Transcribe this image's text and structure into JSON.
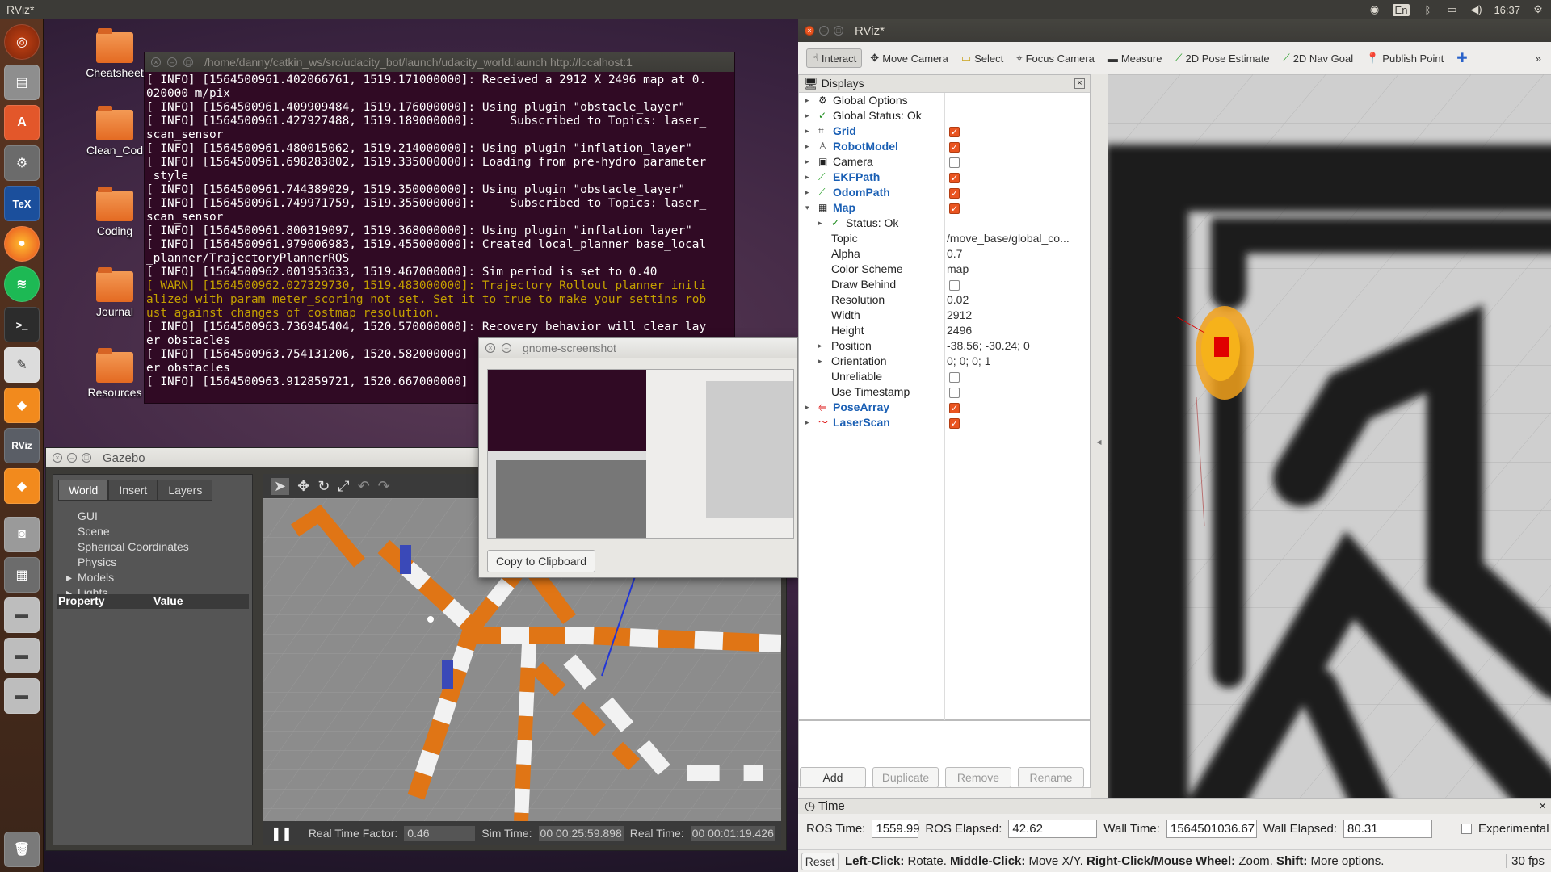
{
  "topbar": {
    "title": "RViz*",
    "time": "16:37",
    "lang": "En",
    "icons": [
      "wifi-icon",
      "keyboard-lang-icon",
      "bluetooth-icon",
      "battery-icon",
      "volume-icon",
      "settings-gear-icon"
    ]
  },
  "launcher": {
    "icons": [
      "ubuntu-dash-icon",
      "files-icon",
      "software-center-icon",
      "system-settings-icon",
      "texmaker-icon",
      "firefox-icon",
      "spotify-icon",
      "terminal-icon",
      "text-editor-icon",
      "sublime-icon",
      "rviz-icon",
      "sublime-icon",
      "screenshot-icon",
      "workspace-icon",
      "drive-icon",
      "drive-icon",
      "drive-icon",
      "trash-icon"
    ],
    "rviz_label": "RViz"
  },
  "desktop": {
    "folders": [
      "Cheatsheet",
      "Clean_Cod",
      "Coding",
      "Journal",
      "Resources"
    ]
  },
  "terminal": {
    "title": "/home/danny/catkin_ws/src/udacity_bot/launch/udacity_world.launch http://localhost:1",
    "lines": [
      "[ INFO] [1564500961.402066761, 1519.171000000]: Received a 2912 X 2496 map at 0.",
      "020000 m/pix",
      "[ INFO] [1564500961.409909484, 1519.176000000]: Using plugin \"obstacle_layer\"",
      "[ INFO] [1564500961.427927488, 1519.189000000]:     Subscribed to Topics: laser_",
      "scan_sensor",
      "[ INFO] [1564500961.480015062, 1519.214000000]: Using plugin \"inflation_layer\"",
      "[ INFO] [1564500961.698283802, 1519.335000000]: Loading from pre-hydro parameter",
      " style",
      "[ INFO] [1564500961.744389029, 1519.350000000]: Using plugin \"obstacle_layer\"",
      "[ INFO] [1564500961.749971759, 1519.355000000]:     Subscribed to Topics: laser_",
      "scan_sensor",
      "[ INFO] [1564500961.800319097, 1519.368000000]: Using plugin \"inflation_layer\"",
      "[ INFO] [1564500961.979006983, 1519.455000000]: Created local_planner base_local",
      "_planner/TrajectoryPlannerROS",
      "[ INFO] [1564500962.001953633, 1519.467000000]: Sim period is set to 0.40"
    ],
    "warn_lines": [
      "[ WARN] [1564500962.027329730, 1519.483000000]: Trajectory Rollout planner initi",
      "alized with param meter_scoring not set. Set it to true to make your settins rob",
      "ust against changes of costmap resolution."
    ],
    "tail_lines": [
      "[ INFO] [1564500963.736945404, 1520.570000000]: Recovery behavior will clear lay",
      "er obstacles",
      "[ INFO] [1564500963.754131206, 1520.582000000]",
      "er obstacles",
      "[ INFO] [1564500963.912859721, 1520.667000000]"
    ]
  },
  "gazebo": {
    "title": "Gazebo",
    "tabs": [
      "World",
      "Insert",
      "Layers"
    ],
    "tree": [
      "GUI",
      "Scene",
      "Spherical Coordinates",
      "Physics",
      "Models",
      "Lights"
    ],
    "prop_header": [
      "Property",
      "Value"
    ],
    "footer": {
      "rtf_label": "Real Time Factor:",
      "rtf_value": "0.46",
      "sim_label": "Sim Time:",
      "sim_value": "00 00:25:59.898",
      "real_label": "Real Time:",
      "real_value": "00 00:01:19.426"
    }
  },
  "screenshot_dialog": {
    "title": "gnome-screenshot",
    "copy_button": "Copy to Clipboard"
  },
  "rviz": {
    "title": "RViz*",
    "tools": [
      "Interact",
      "Move Camera",
      "Select",
      "Focus Camera",
      "Measure",
      "2D Pose Estimate",
      "2D Nav Goal",
      "Publish Point"
    ],
    "displays_title": "Displays",
    "rows": [
      {
        "name": "Global Options",
        "value": ""
      },
      {
        "name": "Global Status: Ok",
        "value": ""
      },
      {
        "name": "Grid",
        "value": ""
      },
      {
        "name": "RobotModel",
        "value": ""
      },
      {
        "name": "Camera",
        "value": ""
      },
      {
        "name": "EKFPath",
        "value": ""
      },
      {
        "name": "OdomPath",
        "value": ""
      },
      {
        "name": "Map",
        "value": ""
      },
      {
        "name": "Status: Ok",
        "value": ""
      },
      {
        "name": "Topic",
        "value": "/move_base/global_co..."
      },
      {
        "name": "Alpha",
        "value": "0.7"
      },
      {
        "name": "Color Scheme",
        "value": "map"
      },
      {
        "name": "Draw Behind",
        "value": ""
      },
      {
        "name": "Resolution",
        "value": "0.02"
      },
      {
        "name": "Width",
        "value": "2912"
      },
      {
        "name": "Height",
        "value": "2496"
      },
      {
        "name": "Position",
        "value": "-38.56; -30.24; 0"
      },
      {
        "name": "Orientation",
        "value": "0; 0; 0; 1"
      },
      {
        "name": "Unreliable",
        "value": ""
      },
      {
        "name": "Use Timestamp",
        "value": ""
      },
      {
        "name": "PoseArray",
        "value": ""
      },
      {
        "name": "LaserScan",
        "value": ""
      }
    ],
    "buttons": [
      "Add",
      "Duplicate",
      "Remove",
      "Rename"
    ],
    "time": {
      "title": "Time",
      "ros_time_label": "ROS Time:",
      "ros_time": "1559.99",
      "ros_elapsed_label": "ROS Elapsed:",
      "ros_elapsed": "42.62",
      "wall_time_label": "Wall Time:",
      "wall_time": "1564501036.67",
      "wall_elapsed_label": "Wall Elapsed:",
      "wall_elapsed": "80.31",
      "experimental": "Experimental"
    },
    "status": {
      "reset": "Reset",
      "left": "Left-Click:",
      "left_t": " Rotate. ",
      "middle": "Middle-Click:",
      "middle_t": " Move X/Y. ",
      "right": "Right-Click/Mouse Wheel:",
      "right_t": " Zoom. ",
      "shift": "Shift:",
      "shift_t": " More options.",
      "fps": "30 fps"
    }
  }
}
